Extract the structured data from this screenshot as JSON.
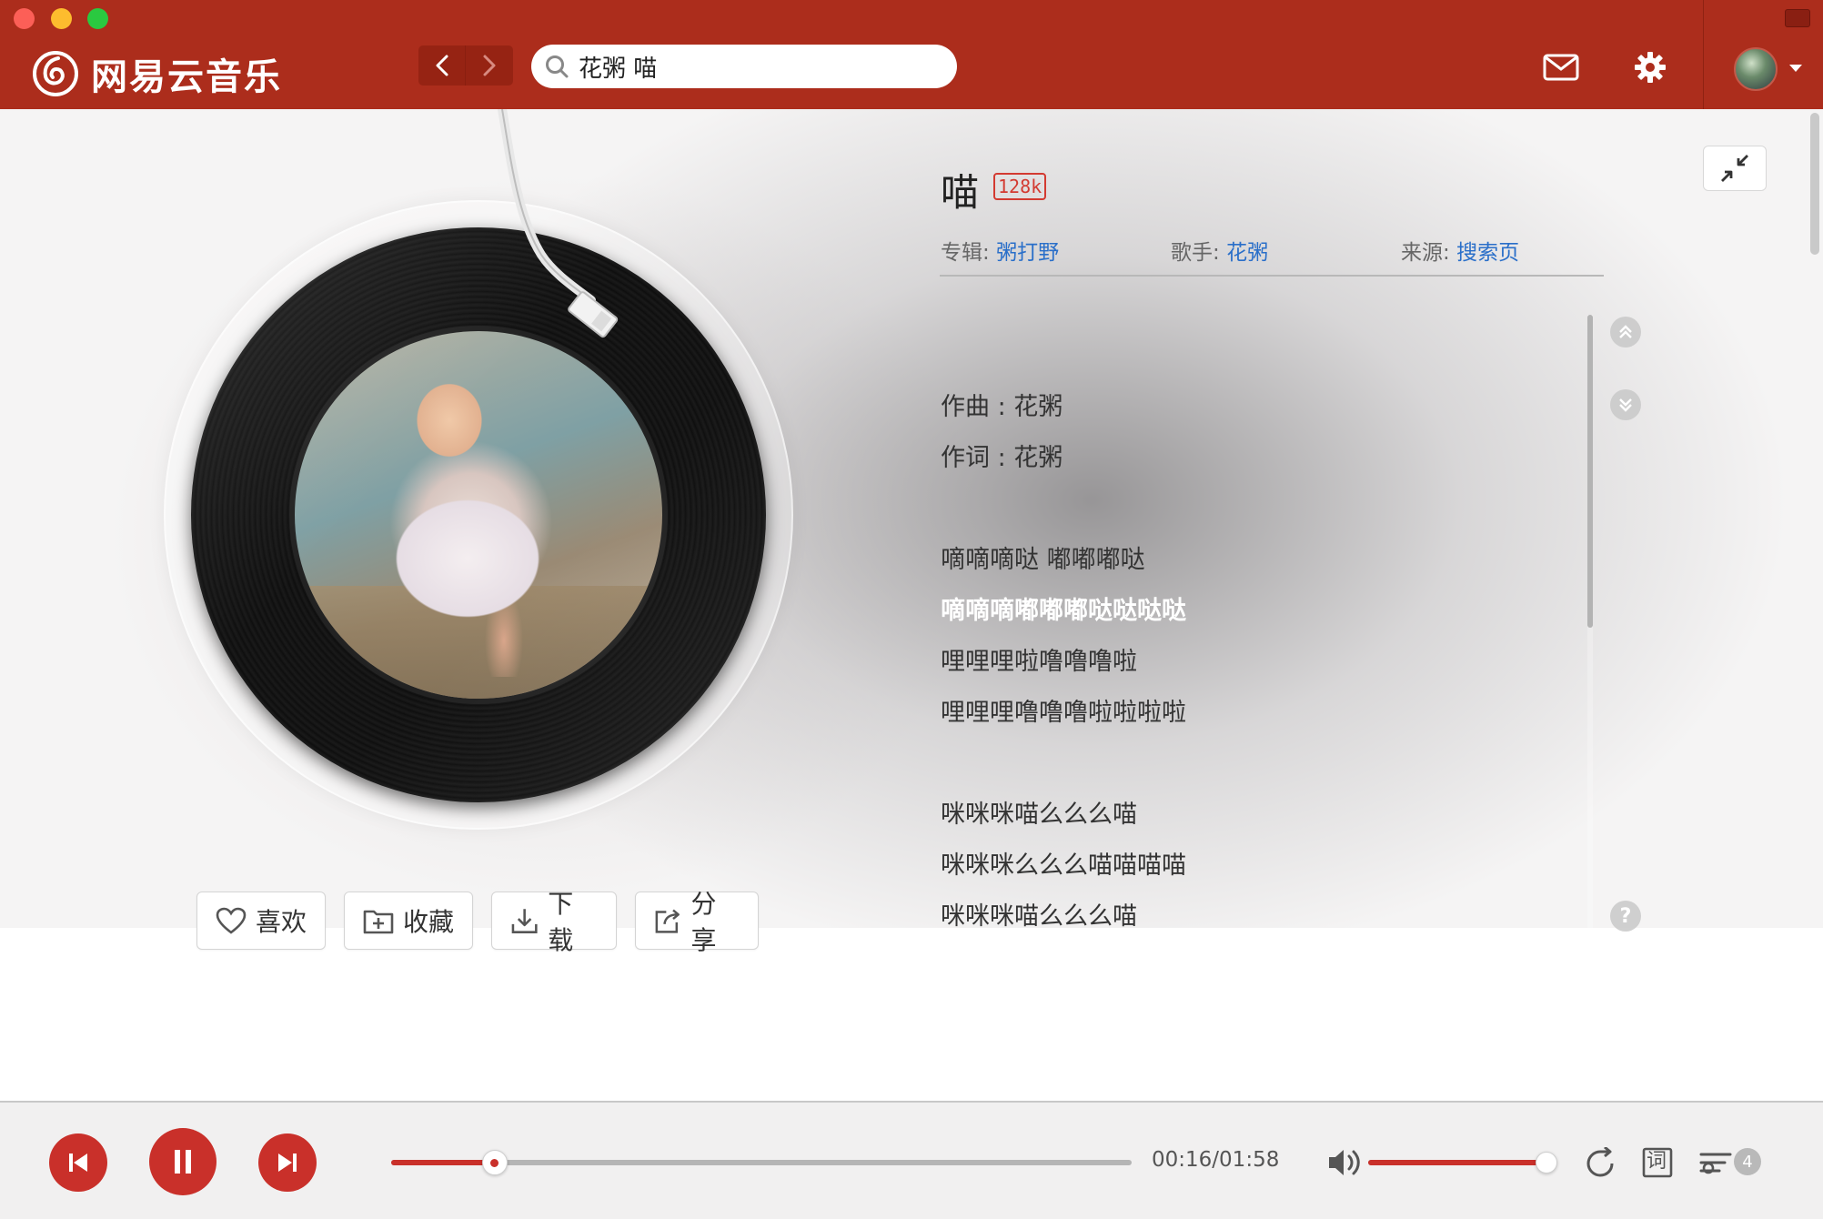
{
  "app": {
    "name": "网易云音乐",
    "colors": {
      "brand": "#ac2d1c",
      "accent": "#c9302a",
      "link": "#2a6fc9"
    }
  },
  "toolbar": {
    "search_value": "花粥 喵",
    "icons": [
      "chevron-left-icon",
      "chevron-right-icon",
      "search-icon",
      "mail-icon",
      "gear-icon",
      "caret-down-icon"
    ]
  },
  "song": {
    "title": "喵",
    "quality": "128k",
    "album_label": "专辑:",
    "album": "粥打野",
    "artist_label": "歌手:",
    "artist": "花粥",
    "source_label": "来源:",
    "source": "搜索页"
  },
  "actions": {
    "like": "喜欢",
    "collect": "收藏",
    "download": "下载",
    "share": "分享"
  },
  "lyrics": {
    "lines": [
      "作曲 : 花粥",
      "作词 : 花粥",
      "",
      "嘀嘀嘀哒 嘟嘟嘟哒",
      "嘀嘀嘀嘟嘟嘟哒哒哒哒",
      "哩哩哩啦噜噜噜啦",
      "哩哩哩噜噜噜啦啦啦啦",
      "",
      "咪咪咪喵么么么喵",
      "咪咪咪么么么喵喵喵喵",
      "咪咪咪喵么么么喵"
    ],
    "active_index": 4,
    "help": "?"
  },
  "player": {
    "elapsed": "00:16",
    "duration": "01:58",
    "time_separator": "/",
    "progress": 0.14,
    "volume": 0.94,
    "playlist_count": "4",
    "lyric_toggle": "词"
  }
}
